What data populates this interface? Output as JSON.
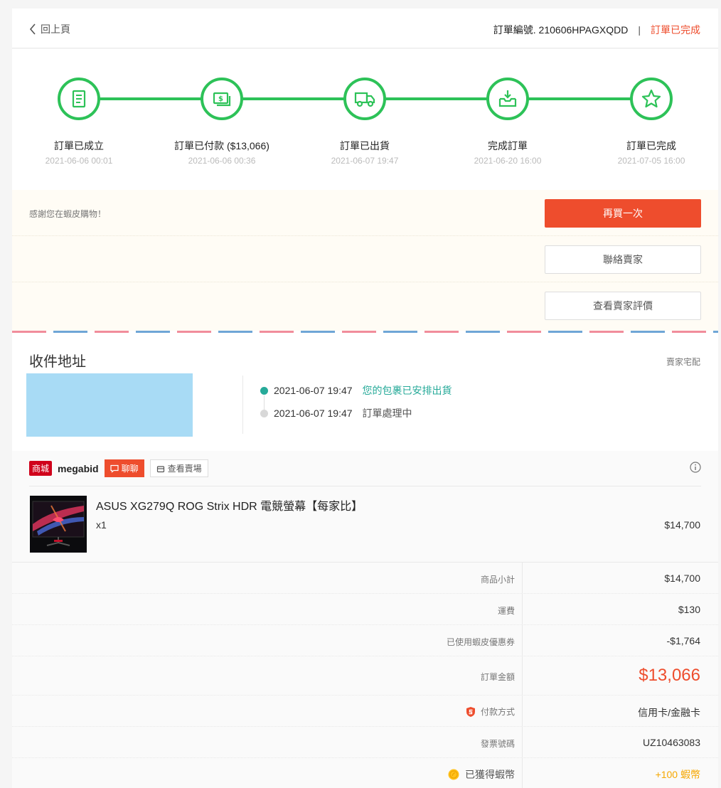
{
  "header": {
    "back_label": "回上頁",
    "order_number": "訂單編號. 210606HPAGXQDD",
    "separator": "|",
    "order_status": "訂單已完成"
  },
  "steps": [
    {
      "label": "訂單已成立",
      "time": "2021-06-06 00:01",
      "icon": "receipt-icon"
    },
    {
      "label": "訂單已付款 ($13,066)",
      "time": "2021-06-06 00:36",
      "icon": "money-icon"
    },
    {
      "label": "訂單已出貨",
      "time": "2021-06-07 19:47",
      "icon": "truck-icon"
    },
    {
      "label": "完成訂單",
      "time": "2021-06-20 16:00",
      "icon": "inbox-download-icon"
    },
    {
      "label": "訂單已完成",
      "time": "2021-07-05 16:00",
      "icon": "star-icon"
    }
  ],
  "actions": {
    "thanks_text": "感謝您在蝦皮購物！",
    "buy_again": "再買一次",
    "contact_seller": "聯絡賣家",
    "view_rating": "查看賣家評價"
  },
  "address": {
    "title": "收件地址",
    "carrier": "賣家宅配",
    "timeline": [
      {
        "time": "2021-06-07 19:47",
        "text": "您的包裹已安排出貨",
        "active": true
      },
      {
        "time": "2021-06-07 19:47",
        "text": "訂單處理中",
        "active": false
      }
    ]
  },
  "shop": {
    "badge": "商城",
    "name": "megabid",
    "chat_label": "聊聊",
    "view_shop_label": "查看賣場"
  },
  "product": {
    "name": "ASUS XG279Q ROG Strix HDR 電競螢幕【每家比】",
    "quantity": "x1",
    "price": "$14,700"
  },
  "summary": {
    "subtotal_label": "商品小計",
    "subtotal": "$14,700",
    "shipping_label": "運費",
    "shipping": "$130",
    "voucher_label": "已使用蝦皮優惠券",
    "voucher": "-$1,764",
    "total_label": "訂單金額",
    "total": "$13,066",
    "payment_label": "付款方式",
    "payment": "信用卡/金融卡",
    "invoice_label": "發票號碼",
    "invoice": "UZ10463083",
    "coins_label": "已獲得蝦幣",
    "coins": "+100 蝦幣"
  },
  "colors": {
    "accent": "#ee4d2d",
    "progress": "#2dc258",
    "teal": "#26aa99",
    "coin": "#f6a700"
  }
}
